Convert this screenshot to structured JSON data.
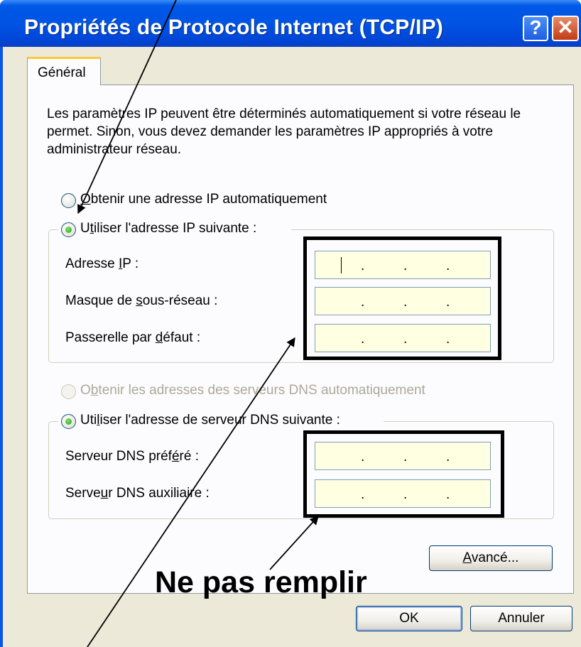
{
  "window": {
    "title": "Propriétés de Protocole Internet (TCP/IP)",
    "help_label": "?",
    "close_label": "✕"
  },
  "tabs": [
    {
      "label": "Général",
      "selected": true
    }
  ],
  "intro_text": "Les paramètres IP peuvent être déterminés automatiquement si votre réseau le permet. Sinon, vous devez demander les paramètres IP appropriés à votre administrateur réseau.",
  "ip_section": {
    "auto_radio": {
      "pre": "",
      "key": "O",
      "post": "btenir une adresse IP automatiquement",
      "checked": false
    },
    "manual_radio": {
      "pre": "U",
      "key": "t",
      "post": "iliser l'adresse IP suivante :",
      "checked": true
    },
    "fields": [
      {
        "pre": "Adresse ",
        "key": "I",
        "post": "P :",
        "value": ". . ."
      },
      {
        "pre": "Masque de ",
        "key": "s",
        "post": "ous-réseau :",
        "value": ". . ."
      },
      {
        "pre": "Passerelle par ",
        "key": "d",
        "post": "éfaut :",
        "value": ". . ."
      }
    ]
  },
  "dns_section": {
    "auto_radio": {
      "pre": "O",
      "key": "b",
      "post": "tenir les adresses des serveurs DNS automatiquement",
      "checked": false,
      "disabled": true
    },
    "manual_radio": {
      "pre": "Uti",
      "key": "l",
      "post": "iser l'adresse de serveur DNS suivante :",
      "checked": true
    },
    "fields": [
      {
        "pre": "Serveur DNS préf",
        "key": "é",
        "post": "ré :",
        "value": ". . ."
      },
      {
        "pre": "Serve",
        "key": "u",
        "post": "r DNS auxiliaire :",
        "value": ". . ."
      }
    ]
  },
  "buttons": {
    "advanced": {
      "key": "A",
      "post": "vancé..."
    },
    "ok": "OK",
    "cancel": "Annuler"
  },
  "annotation": "Ne pas remplir",
  "colors": {
    "titlebar": "#0054e3",
    "dialog_bg": "#ece9d8",
    "field_bg": "#ffffe1",
    "tab_accent": "#ffc83c"
  }
}
